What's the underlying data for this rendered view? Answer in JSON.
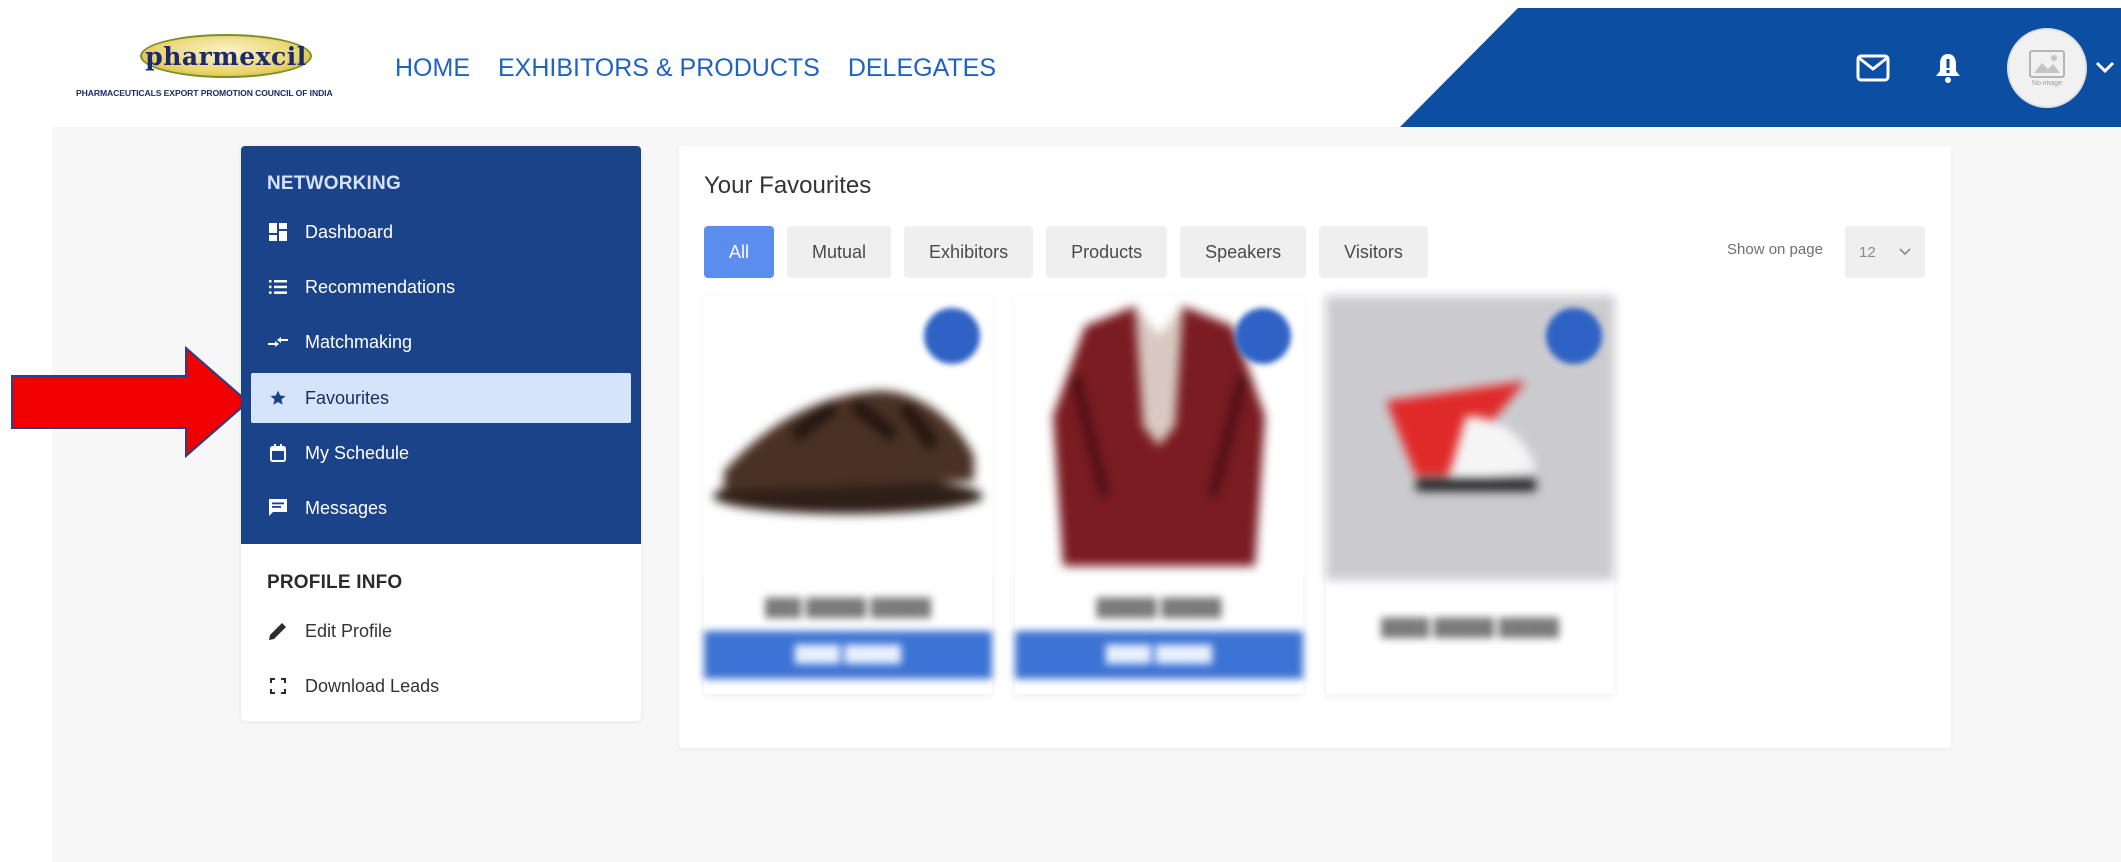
{
  "header": {
    "logo_word": "pharmexcil",
    "logo_tagline": "PHARMACEUTICALS EXPORT PROMOTION COUNCIL OF INDIA",
    "nav": [
      {
        "label": "HOME"
      },
      {
        "label": "EXHIBITORS & PRODUCTS"
      },
      {
        "label": "DELEGATES"
      }
    ],
    "avatar_text": "No image",
    "icons": [
      "mail-icon",
      "bell-icon",
      "avatar-image-icon",
      "chevron-down-icon"
    ],
    "brand_color": "#0b4ea2"
  },
  "sidebar": {
    "networking_heading": "NETWORKING",
    "networking_items": [
      {
        "label": "Dashboard",
        "icon": "dashboard-icon"
      },
      {
        "label": "Recommendations",
        "icon": "list-icon"
      },
      {
        "label": "Matchmaking",
        "icon": "swap-arrows-icon"
      },
      {
        "label": "Favourites",
        "icon": "star-icon",
        "active": true
      },
      {
        "label": "My Schedule",
        "icon": "calendar-icon"
      },
      {
        "label": "Messages",
        "icon": "chat-icon"
      }
    ],
    "profile_heading": "PROFILE INFO",
    "profile_items": [
      {
        "label": "Edit Profile",
        "icon": "pencil-icon"
      },
      {
        "label": "Download Leads",
        "icon": "fullscreen-brackets-icon"
      }
    ],
    "sidebar_color": "#1b4389",
    "active_color": "#d5e3fb"
  },
  "main": {
    "title": "Your Favourites",
    "tabs": [
      {
        "label": "All",
        "active": true
      },
      {
        "label": "Mutual"
      },
      {
        "label": "Exhibitors"
      },
      {
        "label": "Products"
      },
      {
        "label": "Speakers"
      },
      {
        "label": "Visitors"
      }
    ],
    "show_on_page_label": "Show on page",
    "show_on_page_value": "12",
    "accent_color": "#5b8def"
  },
  "annotation": {
    "icon": "red-arrow-icon",
    "color": "#f00000"
  }
}
